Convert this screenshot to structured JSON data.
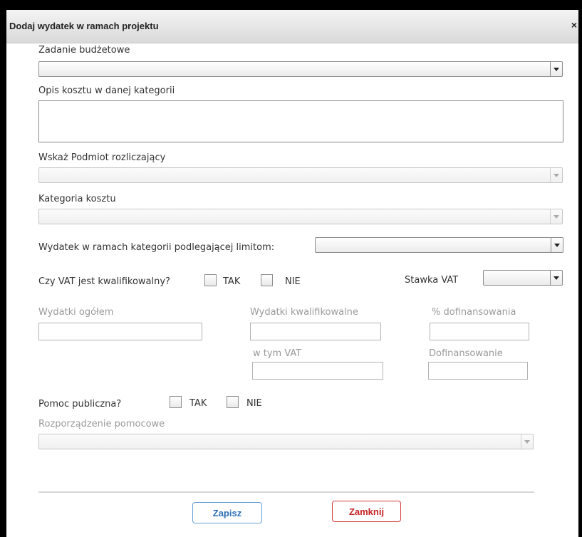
{
  "dialog": {
    "title": "Dodaj wydatek w ramach projektu",
    "close_icon": "×"
  },
  "form": {
    "budget_task_label": "Zadanie budżetowe",
    "cost_desc_label": "Opis kosztu w danej kategorii",
    "entity_label": "Wskaż Podmiot rozliczający",
    "cost_category_label": "Kategoria kosztu",
    "limited_category_label": "Wydatek w ramach kategorii podlegającej limitom:",
    "vat_eligible_label": "Czy VAT jest kwalifikowalny?",
    "yes_label": "TAK",
    "no_label": "NIE",
    "vat_rate_label": "Stawka VAT",
    "total_expenses_label": "Wydatki ogółem",
    "eligible_expenses_label": "Wydatki kwalifikowalne",
    "cofinancing_pct_label": "% dofinansowania",
    "incl_vat_label": "w tym VAT",
    "cofinancing_label": "Dofinansowanie",
    "public_aid_label": "Pomoc publiczna?",
    "aid_regulation_label": "Rozporządzenie pomocowe"
  },
  "buttons": {
    "save": "Zapisz",
    "close": "Zamknij"
  },
  "icons": {
    "dropdown": "chevron-down-icon",
    "close": "close-icon"
  },
  "colors": {
    "save_border": "#6a9ed4",
    "close_border": "#d23b3b",
    "disabled_text": "#9a9a9a"
  }
}
